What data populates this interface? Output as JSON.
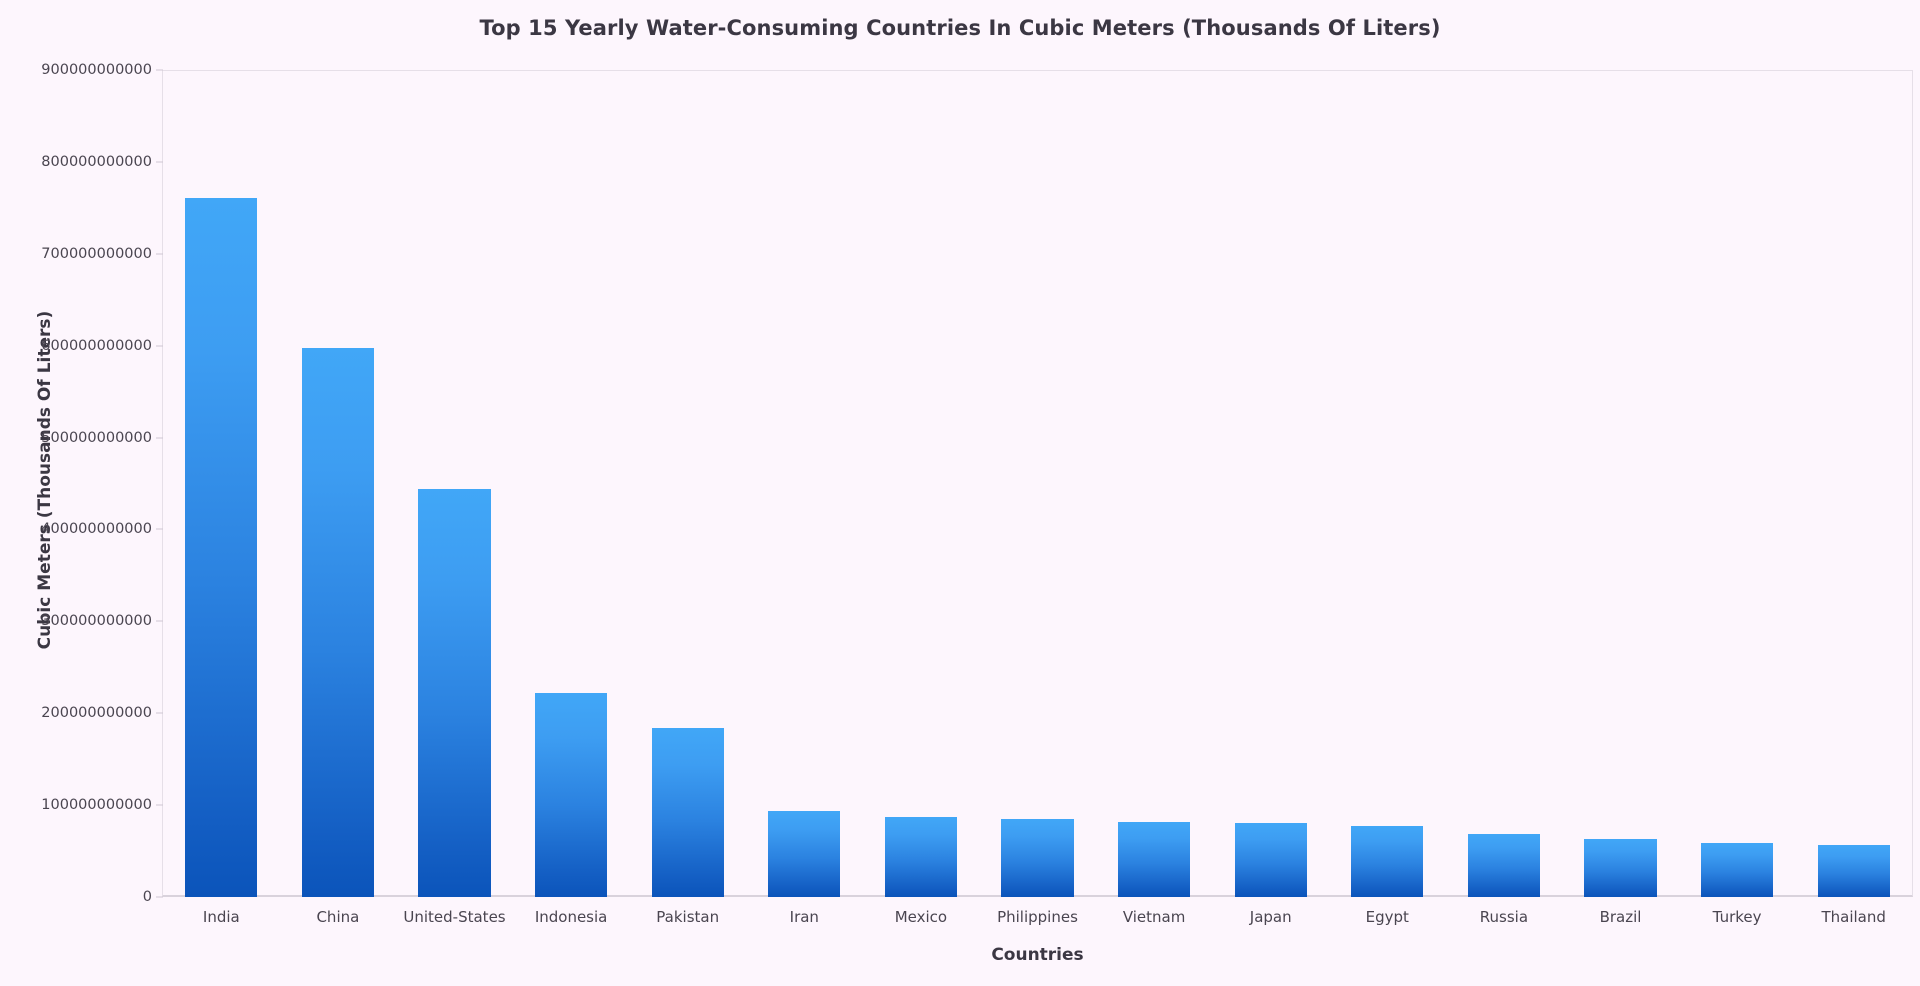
{
  "chart_data": {
    "type": "bar",
    "title": "Top 15 Yearly Water-Consuming Countries In Cubic Meters (Thousands Of Liters)",
    "xlabel": "Countries",
    "ylabel": "Cubic Meters (Thousands Of Liters)",
    "categories": [
      "India",
      "China",
      "United-States",
      "Indonesia",
      "Pakistan",
      "Iran",
      "Mexico",
      "Philippines",
      "Vietnam",
      "Japan",
      "Egypt",
      "Russia",
      "Brazil",
      "Turkey",
      "Thailand"
    ],
    "values": [
      761000000000,
      598000000000,
      444000000000,
      222500000000,
      183500000000,
      94000000000,
      87000000000,
      85000000000,
      82000000000,
      81000000000,
      77000000000,
      69000000000,
      63000000000,
      59000000000,
      57000000000
    ],
    "ylim": [
      0,
      900000000000
    ],
    "ytick_values": [
      0,
      100000000000,
      200000000000,
      300000000000,
      400000000000,
      500000000000,
      600000000000,
      700000000000,
      800000000000,
      900000000000
    ],
    "ytick_labels": [
      "0",
      "100000000000",
      "200000000000",
      "300000000000",
      "400000000000",
      "500000000000",
      "600000000000",
      "700000000000",
      "800000000000",
      "900000000000"
    ],
    "grid": false,
    "legend": null,
    "bar_gradient": {
      "top_color": "#41a7f7",
      "bottom_color": "#0b54ba"
    },
    "background_color": "#fdf6fd",
    "text_color": "#3b3743",
    "axis_line_color": "#d9d2dc"
  }
}
